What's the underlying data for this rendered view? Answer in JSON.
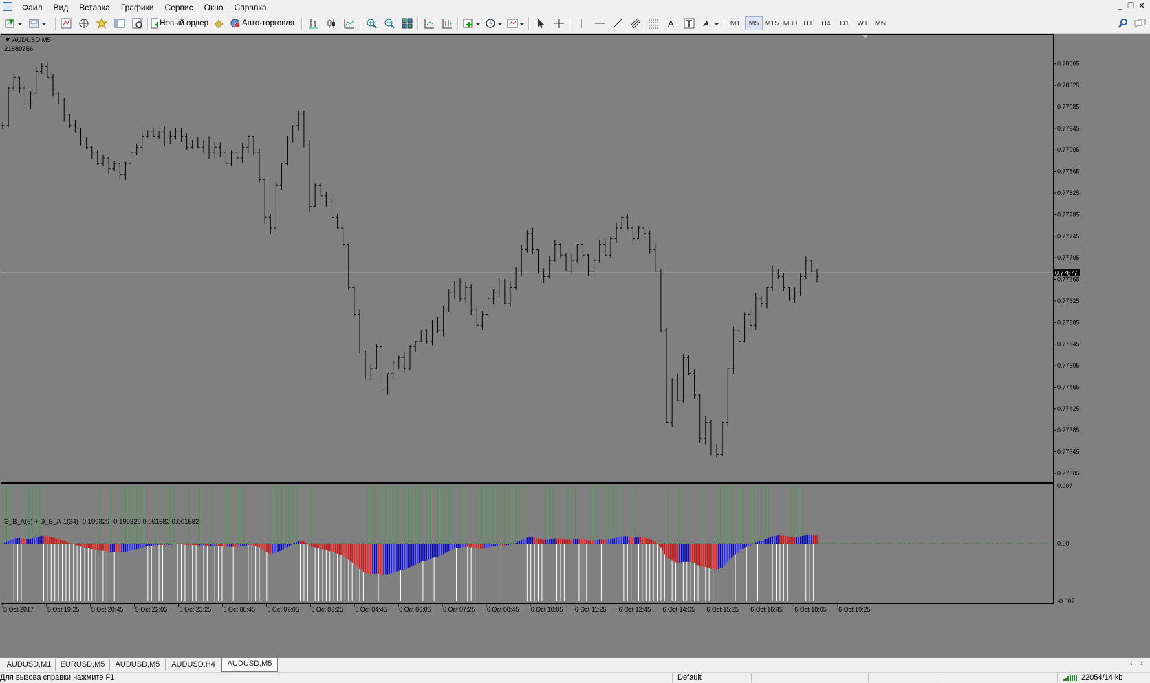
{
  "menu": [
    "Файл",
    "Вид",
    "Вставка",
    "Графики",
    "Сервис",
    "Окно",
    "Справка"
  ],
  "toolbar": {
    "new_order": "Новый ордер",
    "autotrading": "Авто-торговля",
    "timeframes": [
      "M1",
      "M5",
      "M15",
      "M30",
      "H1",
      "H4",
      "D1",
      "W1",
      "MN"
    ],
    "active_timeframe": "M5",
    "icons": [
      "new-chart-icon",
      "profiles-icon",
      "market-watch-icon",
      "navigator-icon",
      "data-window-icon",
      "terminal-icon",
      "tester-icon",
      "new-order-icon",
      "autotrading-icon",
      "bar-chart-icon",
      "candlestick-icon",
      "line-chart-icon",
      "zoom-in-icon",
      "zoom-out-icon",
      "tile-windows-icon",
      "autoscroll-icon",
      "chart-shift-icon",
      "indicators-icon",
      "periods-icon",
      "templates-icon",
      "cursor-icon",
      "crosshair-icon",
      "vertical-line-icon",
      "horizontal-line-icon",
      "trend-line-icon",
      "equidistant-channel-icon",
      "fibonacci-icon",
      "text-icon",
      "text-label-icon",
      "arrows-icon",
      "search-icon",
      "chat-icon"
    ]
  },
  "chart": {
    "symbol": "AUDUSD,M5",
    "sub_id": "21889756",
    "current_price": "0.77677",
    "price_ticks": [
      "0.78065",
      "0.78025",
      "0.77985",
      "0.77945",
      "0.77905",
      "0.77865",
      "0.77825",
      "0.77785",
      "0.77745",
      "0.77705",
      "0.77665",
      "0.77625",
      "0.77585",
      "0.77545",
      "0.77505",
      "0.77465",
      "0.77425",
      "0.77385",
      "0.77345",
      "0.77305"
    ],
    "time_ticks": [
      "5 Oct 2017",
      "5 Oct 19:25",
      "5 Oct 20:45",
      "5 Oct 22:05",
      "5 Oct 23:25",
      "6 Oct 00:45",
      "6 Oct 02:05",
      "6 Oct 03:25",
      "6 Oct 04:45",
      "6 Oct 06:05",
      "6 Oct 07:25",
      "6 Oct 08:45",
      "6 Oct 10:05",
      "6 Oct 11:25",
      "6 Oct 12:45",
      "6 Oct 14:05",
      "6 Oct 15:25",
      "6 Oct 16:45",
      "6 Oct 18:05",
      "6 Oct 19:25"
    ]
  },
  "chart_data": {
    "type": "bar",
    "title": "AUDUSD,M5",
    "ylim": [
      0.77305,
      0.78085
    ],
    "close_prices": [
      0.7795,
      0.7802,
      0.7804,
      0.7802,
      0.7799,
      0.7801,
      0.7805,
      0.7806,
      0.7804,
      0.7801,
      0.7799,
      0.7797,
      0.7795,
      0.7794,
      0.7792,
      0.7791,
      0.779,
      0.7788,
      0.7789,
      0.7787,
      0.7788,
      0.7786,
      0.7788,
      0.779,
      0.7791,
      0.7793,
      0.7794,
      0.7793,
      0.7794,
      0.7792,
      0.7793,
      0.7794,
      0.7793,
      0.7791,
      0.7792,
      0.7791,
      0.7792,
      0.779,
      0.7791,
      0.779,
      0.7788,
      0.779,
      0.7789,
      0.7791,
      0.7793,
      0.779,
      0.7785,
      0.7778,
      0.7776,
      0.7784,
      0.7788,
      0.7792,
      0.7795,
      0.7797,
      0.7792,
      0.778,
      0.7784,
      0.7782,
      0.7781,
      0.7778,
      0.7776,
      0.7773,
      0.7765,
      0.776,
      0.7753,
      0.7748,
      0.775,
      0.7754,
      0.7746,
      0.7749,
      0.7751,
      0.7752,
      0.775,
      0.7754,
      0.7755,
      0.7757,
      0.7755,
      0.7759,
      0.7757,
      0.7761,
      0.7764,
      0.7766,
      0.7763,
      0.7765,
      0.7761,
      0.7758,
      0.776,
      0.7763,
      0.7764,
      0.7766,
      0.7762,
      0.7765,
      0.7768,
      0.7772,
      0.7775,
      0.7772,
      0.7768,
      0.7767,
      0.777,
      0.7773,
      0.7771,
      0.7768,
      0.777,
      0.7773,
      0.7771,
      0.7768,
      0.777,
      0.7773,
      0.7771,
      0.7774,
      0.7776,
      0.7778,
      0.7776,
      0.7774,
      0.7776,
      0.7775,
      0.7772,
      0.7768,
      0.7757,
      0.774,
      0.7748,
      0.7744,
      0.7752,
      0.7749,
      0.7745,
      0.7737,
      0.774,
      0.7735,
      0.7734,
      0.774,
      0.775,
      0.7757,
      0.7755,
      0.776,
      0.7758,
      0.7763,
      0.7762,
      0.7765,
      0.7768,
      0.7767,
      0.7765,
      0.7763,
      0.7764,
      0.7767,
      0.777,
      0.7768,
      0.7767
    ],
    "indicator": {
      "name": "Э_В_А(5) + Э_В_А-1(34)",
      "values": [
        -0.199329,
        -0.199329,
        0.001582,
        0.001582
      ],
      "ylim": [
        -0.007,
        0.007
      ],
      "ticks": [
        "0.007",
        "0.00",
        "-0.007"
      ]
    }
  },
  "tabs": [
    "AUDUSD,M1",
    "EURUSD,M5",
    "AUDUSD,M5",
    "AUDUSD,H4",
    "AUDUSD,M5"
  ],
  "active_tab": 4,
  "status": {
    "help": "Для вызова справки нажмите F1",
    "profile": "Default",
    "traffic": "22054/14 kb"
  },
  "colors": {
    "chart_bg": "#808080",
    "bars": "#000000",
    "price_line": "#c0c0c0",
    "hist_up": "#0000ff",
    "hist_down": "#ff0000",
    "green": "#43a047",
    "white": "#ffffff"
  }
}
